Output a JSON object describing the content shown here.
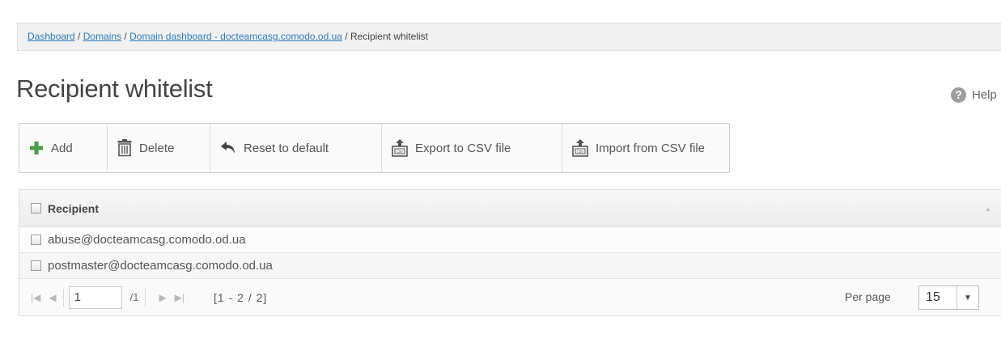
{
  "breadcrumb": {
    "items": [
      "Dashboard",
      "Domains",
      "Domain dashboard - docteamcasg.comodo.od.ua"
    ],
    "current": "Recipient whitelist",
    "separator": " / "
  },
  "page": {
    "title": "Recipient whitelist",
    "help_label": "Help"
  },
  "toolbar": {
    "add_label": "Add",
    "delete_label": "Delete",
    "reset_label": "Reset to default",
    "export_label": "Export to CSV file",
    "import_label": "Import from CSV file"
  },
  "grid": {
    "column_header": "Recipient",
    "rows": [
      "abuse@docteamcasg.comodo.od.ua",
      "postmaster@docteamcasg.comodo.od.ua"
    ]
  },
  "pager": {
    "page_value": "1",
    "total_pages": "/1",
    "range": "[1 - 2 / 2]",
    "per_page_label": "Per page",
    "per_page_value": "15"
  },
  "icons": {
    "add": "plus-icon",
    "delete": "trash-icon",
    "reset": "undo-icon",
    "export": "csv-export-icon",
    "import": "csv-import-icon",
    "help": "help-icon"
  },
  "colors": {
    "link": "#2e7bbf",
    "add_green": "#4a9d4a",
    "toolbar_border": "#cccccc"
  }
}
